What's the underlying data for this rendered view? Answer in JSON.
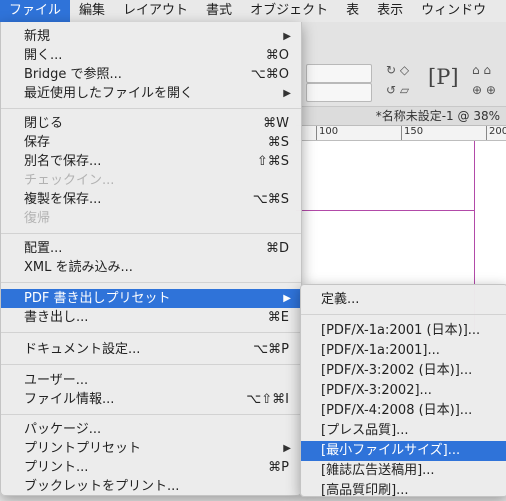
{
  "menubar": {
    "items": [
      "ファイル",
      "編集",
      "レイアウト",
      "書式",
      "オブジェクト",
      "表",
      "表示",
      "ウィンドウ"
    ]
  },
  "document": {
    "tab_title": "*名称未設定-1 @ 38%",
    "ruler_labels": [
      "100",
      "150",
      "200"
    ]
  },
  "file_menu": {
    "items": [
      {
        "label": "新規",
        "shortcut": "",
        "submenu": true
      },
      {
        "label": "開く...",
        "shortcut": "⌘O"
      },
      {
        "label": "Bridge で参照...",
        "shortcut": "⌥⌘O"
      },
      {
        "label": "最近使用したファイルを開く",
        "shortcut": "",
        "submenu": true
      },
      {
        "label": "閉じる",
        "shortcut": "⌘W"
      },
      {
        "label": "保存",
        "shortcut": "⌘S"
      },
      {
        "label": "別名で保存...",
        "shortcut": "⇧⌘S"
      },
      {
        "label": "チェックイン...",
        "shortcut": "",
        "disabled": true
      },
      {
        "label": "複製を保存...",
        "shortcut": "⌥⌘S"
      },
      {
        "label": "復帰",
        "shortcut": "",
        "disabled": true
      },
      {
        "label": "配置...",
        "shortcut": "⌘D"
      },
      {
        "label": "XML を読み込み...",
        "shortcut": ""
      },
      {
        "label": "PDF 書き出しプリセット",
        "shortcut": "",
        "submenu": true,
        "highlighted": true
      },
      {
        "label": "書き出し...",
        "shortcut": "⌘E"
      },
      {
        "label": "ドキュメント設定...",
        "shortcut": "⌥⌘P"
      },
      {
        "label": "ユーザー...",
        "shortcut": ""
      },
      {
        "label": "ファイル情報...",
        "shortcut": "⌥⇧⌘I"
      },
      {
        "label": "パッケージ...",
        "shortcut": ""
      },
      {
        "label": "プリントプリセット",
        "shortcut": "",
        "submenu": true
      },
      {
        "label": "プリント...",
        "shortcut": "⌘P"
      },
      {
        "label": "ブックレットをプリント...",
        "shortcut": ""
      }
    ]
  },
  "pdf_preset_submenu": {
    "items": [
      {
        "label": "定義..."
      },
      {
        "label": "[PDF/X-1a:2001 (日本)]..."
      },
      {
        "label": "[PDF/X-1a:2001]..."
      },
      {
        "label": "[PDF/X-3:2002 (日本)]..."
      },
      {
        "label": "[PDF/X-3:2002]..."
      },
      {
        "label": "[PDF/X-4:2008 (日本)]..."
      },
      {
        "label": "[プレス品質]..."
      },
      {
        "label": "[最小ファイルサイズ]...",
        "highlighted": true
      },
      {
        "label": "[雑誌広告送稿用]..."
      },
      {
        "label": "[高品質印刷]..."
      }
    ]
  },
  "colors": {
    "highlight": "#2f73d9",
    "margin_guide": "#b24aa8"
  }
}
